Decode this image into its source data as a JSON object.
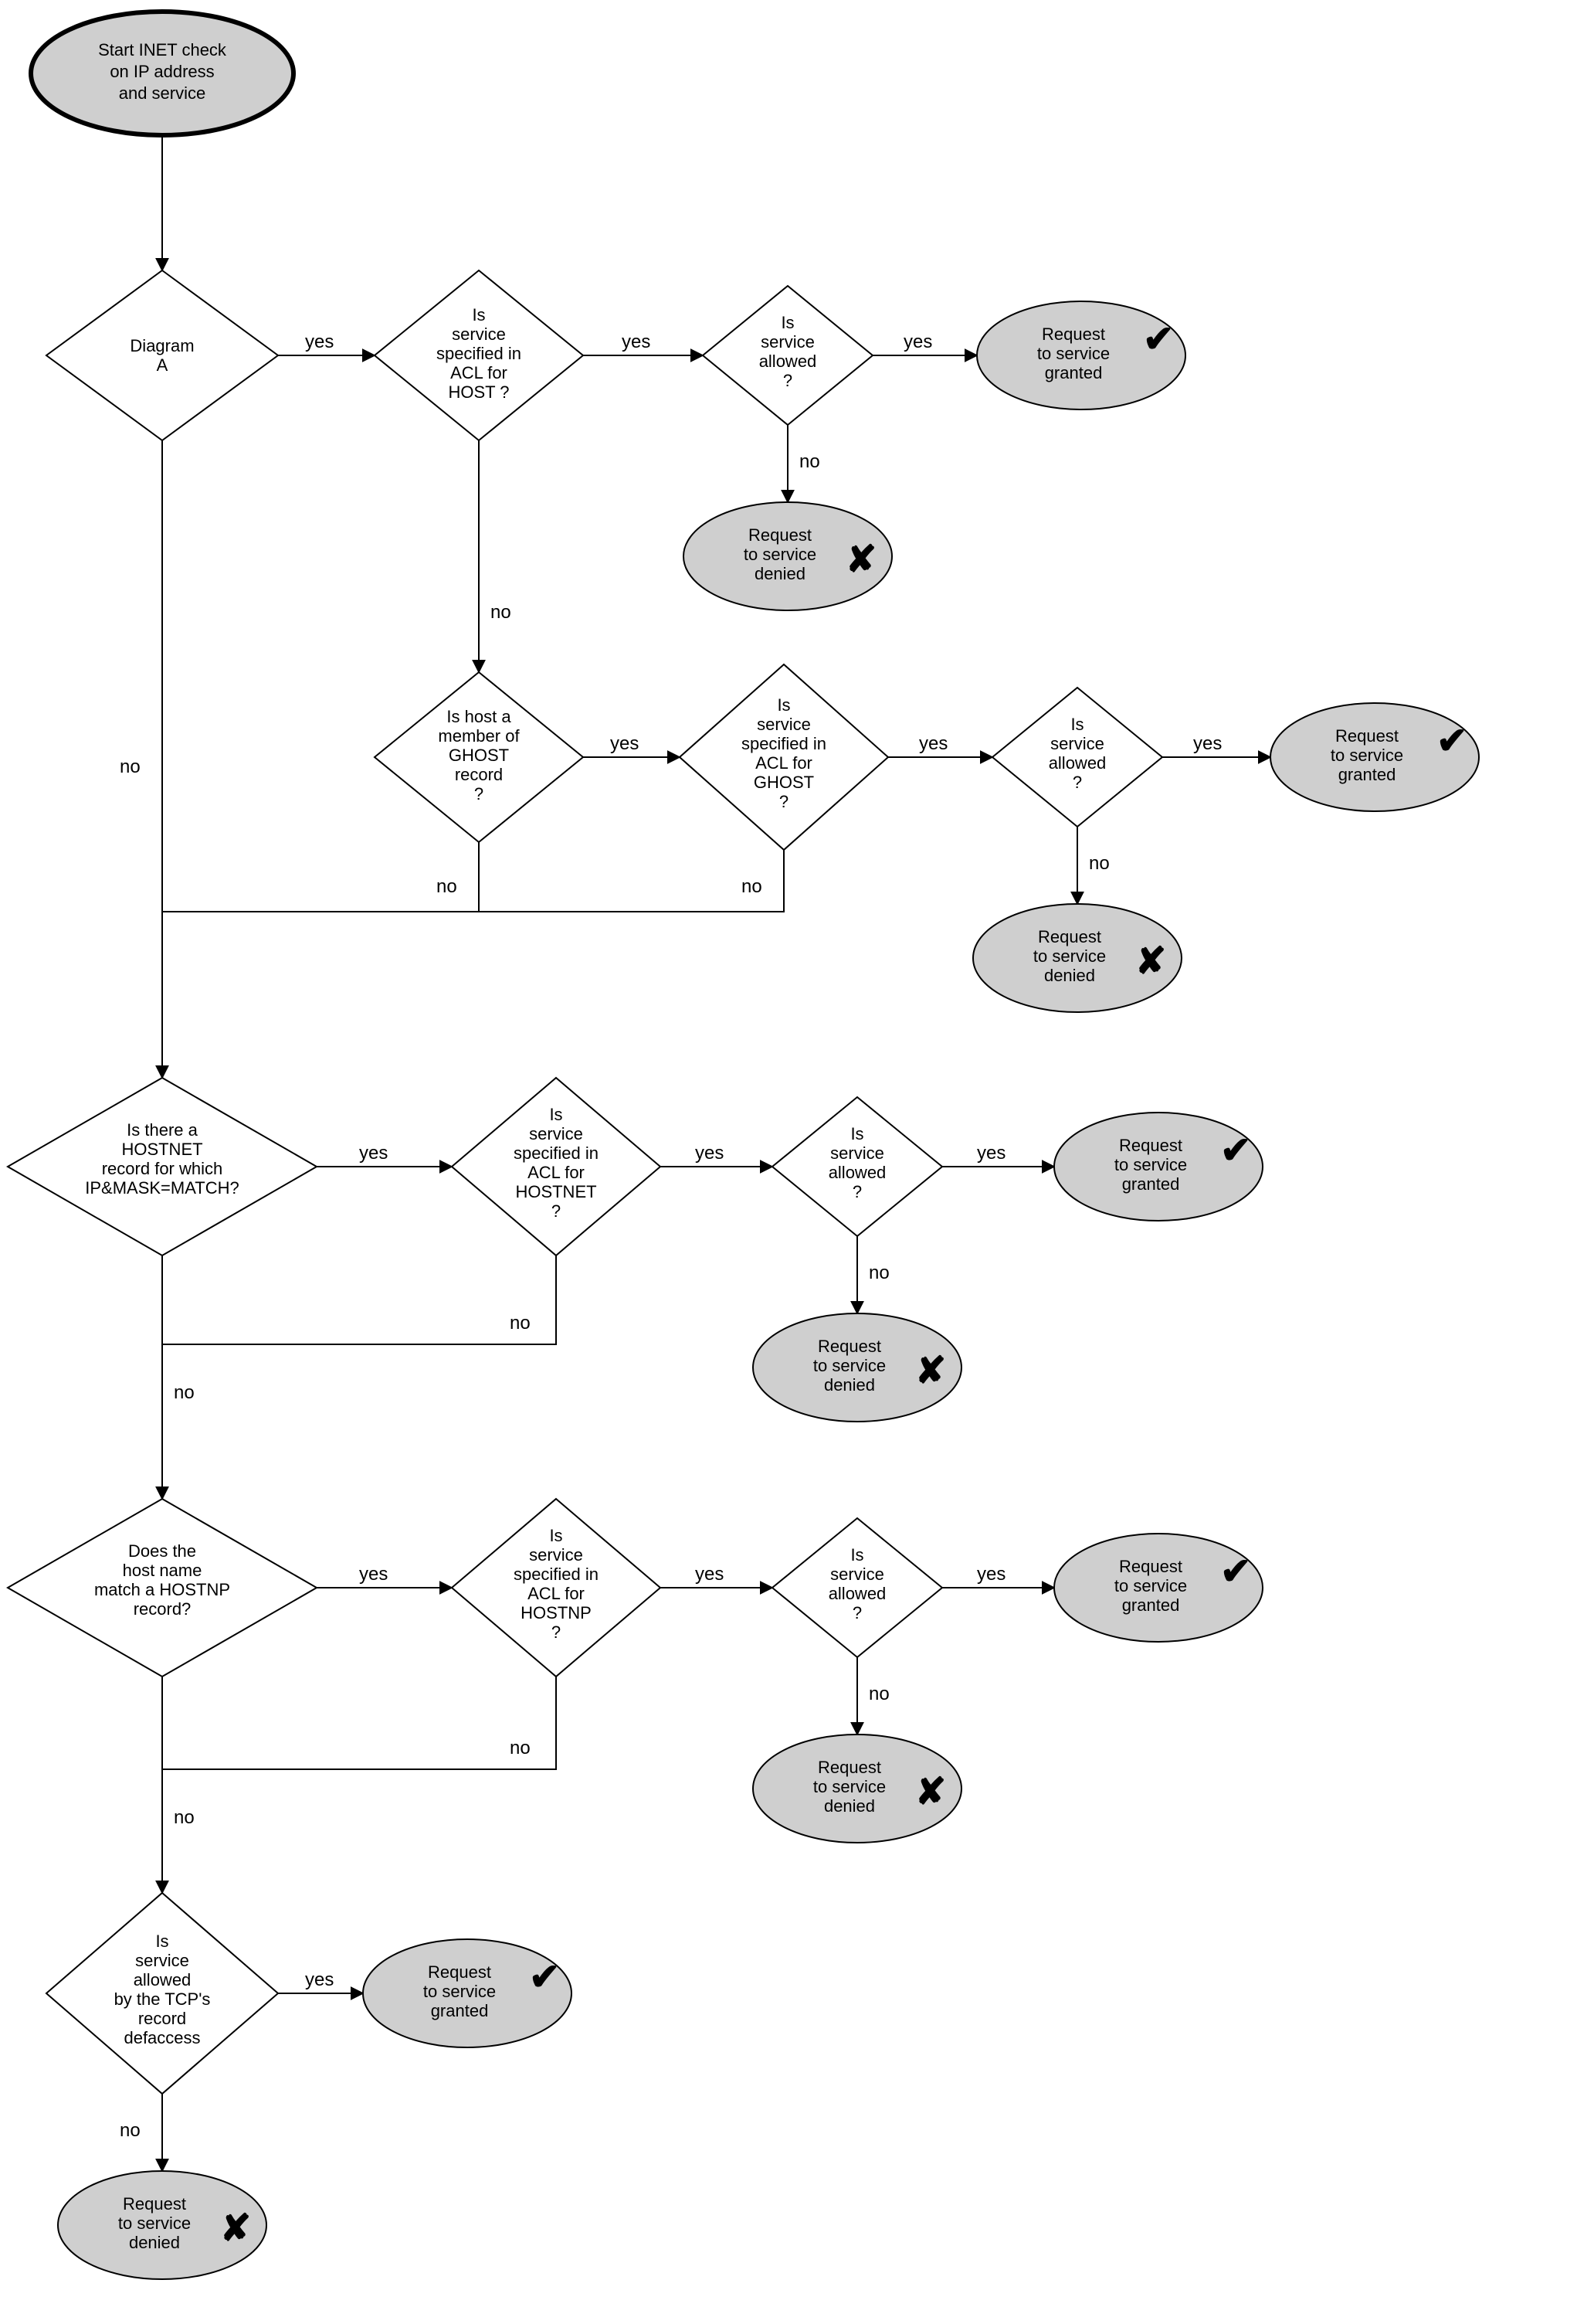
{
  "labels": {
    "yes": "yes",
    "no": "no"
  },
  "mark": {
    "granted": "✔",
    "denied": "✘"
  },
  "nodes": {
    "start": {
      "l1": "Start INET check",
      "l2": "on IP address",
      "l3": "and service"
    },
    "diagramA": {
      "l1": "Diagram",
      "l2": "A"
    },
    "aclHost": {
      "l1": "Is",
      "l2": "service",
      "l3": "specified in",
      "l4": "ACL for",
      "l5": "HOST ?"
    },
    "allowed": {
      "l1": "Is",
      "l2": "service",
      "l3": "allowed",
      "l4": "?"
    },
    "granted": {
      "l1": "Request",
      "l2": "to service",
      "l3": "granted"
    },
    "denied": {
      "l1": "Request",
      "l2": "to service",
      "l3": "denied"
    },
    "ghostMember": {
      "l1": "Is host a",
      "l2": "member of",
      "l3": "GHOST",
      "l4": "record",
      "l5": "?"
    },
    "aclGhost": {
      "l1": "Is",
      "l2": "service",
      "l3": "specified in",
      "l4": "ACL for",
      "l5": "GHOST",
      "l6": "?"
    },
    "hostnet": {
      "l1": "Is there a",
      "l2": "HOSTNET",
      "l3": "record for which",
      "l4": "IP&MASK=MATCH?"
    },
    "aclHostnet": {
      "l1": "Is",
      "l2": "service",
      "l3": "specified in",
      "l4": "ACL for",
      "l5": "HOSTNET",
      "l6": "?"
    },
    "hostnp": {
      "l1": "Does the",
      "l2": "host name",
      "l3": "match a HOSTNP",
      "l4": "record?"
    },
    "aclHostnp": {
      "l1": "Is",
      "l2": "service",
      "l3": "specified in",
      "l4": "ACL for",
      "l5": "HOSTNP",
      "l6": "?"
    },
    "tcpAllowed": {
      "l1": "Is",
      "l2": "service",
      "l3": "allowed",
      "l4": "by the TCP's",
      "l5": "record",
      "l6": "defaccess"
    }
  }
}
